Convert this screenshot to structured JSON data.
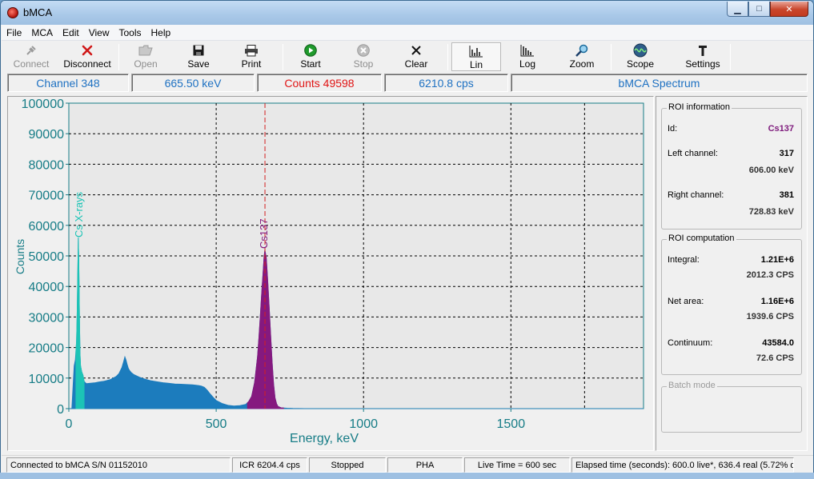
{
  "window": {
    "title": "bMCA",
    "controls": {
      "minimize": "▁",
      "maximize": "□",
      "close": "✕"
    }
  },
  "menu": [
    "File",
    "MCA",
    "Edit",
    "View",
    "Tools",
    "Help"
  ],
  "toolbar": {
    "connect": "Connect",
    "disconnect": "Disconnect",
    "open": "Open",
    "save": "Save",
    "print": "Print",
    "start": "Start",
    "stop": "Stop",
    "clear": "Clear",
    "lin": "Lin",
    "log": "Log",
    "zoom": "Zoom",
    "scope": "Scope",
    "settings": "Settings"
  },
  "info": {
    "channel": "Channel 348",
    "energy": "665.50 keV",
    "counts": "Counts 49598",
    "rate": "6210.8 cps",
    "name": "bMCA Spectrum"
  },
  "roi_info": {
    "title": "ROI information",
    "id_label": "Id:",
    "id": "Cs137",
    "left_label": "Left channel:",
    "left": "317",
    "left_kev": "606.00 keV",
    "right_label": "Right channel:",
    "right": "381",
    "right_kev": "728.83 keV"
  },
  "roi_comp": {
    "title": "ROI computation",
    "integral_label": "Integral:",
    "integral": "1.21E+6",
    "integral_cps": "2012.3 CPS",
    "net_label": "Net area:",
    "net": "1.16E+6",
    "net_cps": "1939.6 CPS",
    "cont_label": "Continuum:",
    "cont": "43584.0",
    "cont_cps": "72.6 CPS"
  },
  "batch": {
    "title": "Batch mode"
  },
  "status": {
    "connection": "Connected to bMCA S/N 01152010",
    "icr": "ICR 6204.4 cps",
    "state": "Stopped",
    "mode": "PHA",
    "live": "Live Time = 600 sec",
    "elapsed": "Elapsed time (seconds): 600.0 live*, 636.4 real (5.72% d"
  },
  "colors": {
    "accent_blue": "#1e71c2",
    "spectrum": "#1c7cbd",
    "xray_roi": "#1cc4b6",
    "cs_roi": "#85197f",
    "axis_teal": "#167c86",
    "cursor": "#d42020"
  },
  "chart_data": {
    "type": "area",
    "xlabel": "Energy, keV",
    "ylabel": "Counts",
    "xlim": [
      0,
      1950
    ],
    "ylim": [
      0,
      100000
    ],
    "xticks": [
      0,
      500,
      1000,
      1500
    ],
    "yticks": [
      0,
      10000,
      20000,
      30000,
      40000,
      50000,
      60000,
      70000,
      80000,
      90000,
      100000
    ],
    "grid": true,
    "cursor_x": 665.5,
    "annotations": [
      {
        "text": "Cs X-rays",
        "x": 32
      },
      {
        "text": "Cs137",
        "x": 662
      }
    ],
    "series": [
      {
        "x": [
          0,
          10,
          18,
          22,
          26,
          28,
          30,
          32,
          34,
          36,
          38,
          40,
          44,
          48,
          52,
          56,
          60,
          70,
          80,
          90,
          100,
          120,
          140,
          160,
          170,
          180,
          186,
          190,
          194,
          198,
          202,
          206,
          212,
          220,
          240,
          260,
          280,
          300,
          320,
          340,
          360,
          380,
          400,
          420,
          440,
          450,
          460,
          470,
          480,
          490,
          500,
          520,
          540,
          560,
          580,
          600,
          610,
          620,
          630,
          640,
          645,
          650,
          655,
          660,
          662,
          665,
          670,
          675,
          680,
          685,
          690,
          695,
          700,
          705,
          710,
          720,
          740,
          760,
          780,
          800,
          850,
          900,
          1000,
          1200,
          1400,
          1600,
          1800,
          1950
        ],
        "y": [
          0,
          0,
          14000,
          16000,
          22000,
          30000,
          42000,
          56000,
          48000,
          30000,
          18000,
          14000,
          12000,
          11000,
          9000,
          8500,
          8200,
          8300,
          8400,
          8500,
          8700,
          9000,
          9500,
          10500,
          11500,
          13500,
          15500,
          17000,
          16000,
          14500,
          13200,
          12500,
          11800,
          11200,
          10300,
          9600,
          9100,
          8800,
          8500,
          8300,
          8100,
          8000,
          7900,
          7800,
          7600,
          7400,
          7000,
          6000,
          4800,
          3700,
          2700,
          1700,
          1100,
          900,
          1000,
          1400,
          2300,
          4000,
          8500,
          17000,
          23500,
          31000,
          39000,
          46000,
          49500,
          52000,
          49500,
          42000,
          33000,
          24000,
          15000,
          8000,
          3500,
          1600,
          700,
          300,
          150,
          80,
          40,
          20,
          10,
          5,
          0,
          0,
          0,
          0,
          0,
          0
        ]
      }
    ],
    "roi_regions": [
      {
        "name": "Cs X-rays",
        "x_from": 24,
        "x_to": 52
      },
      {
        "name": "Cs137",
        "x_from": 606,
        "x_to": 728.83
      }
    ]
  }
}
